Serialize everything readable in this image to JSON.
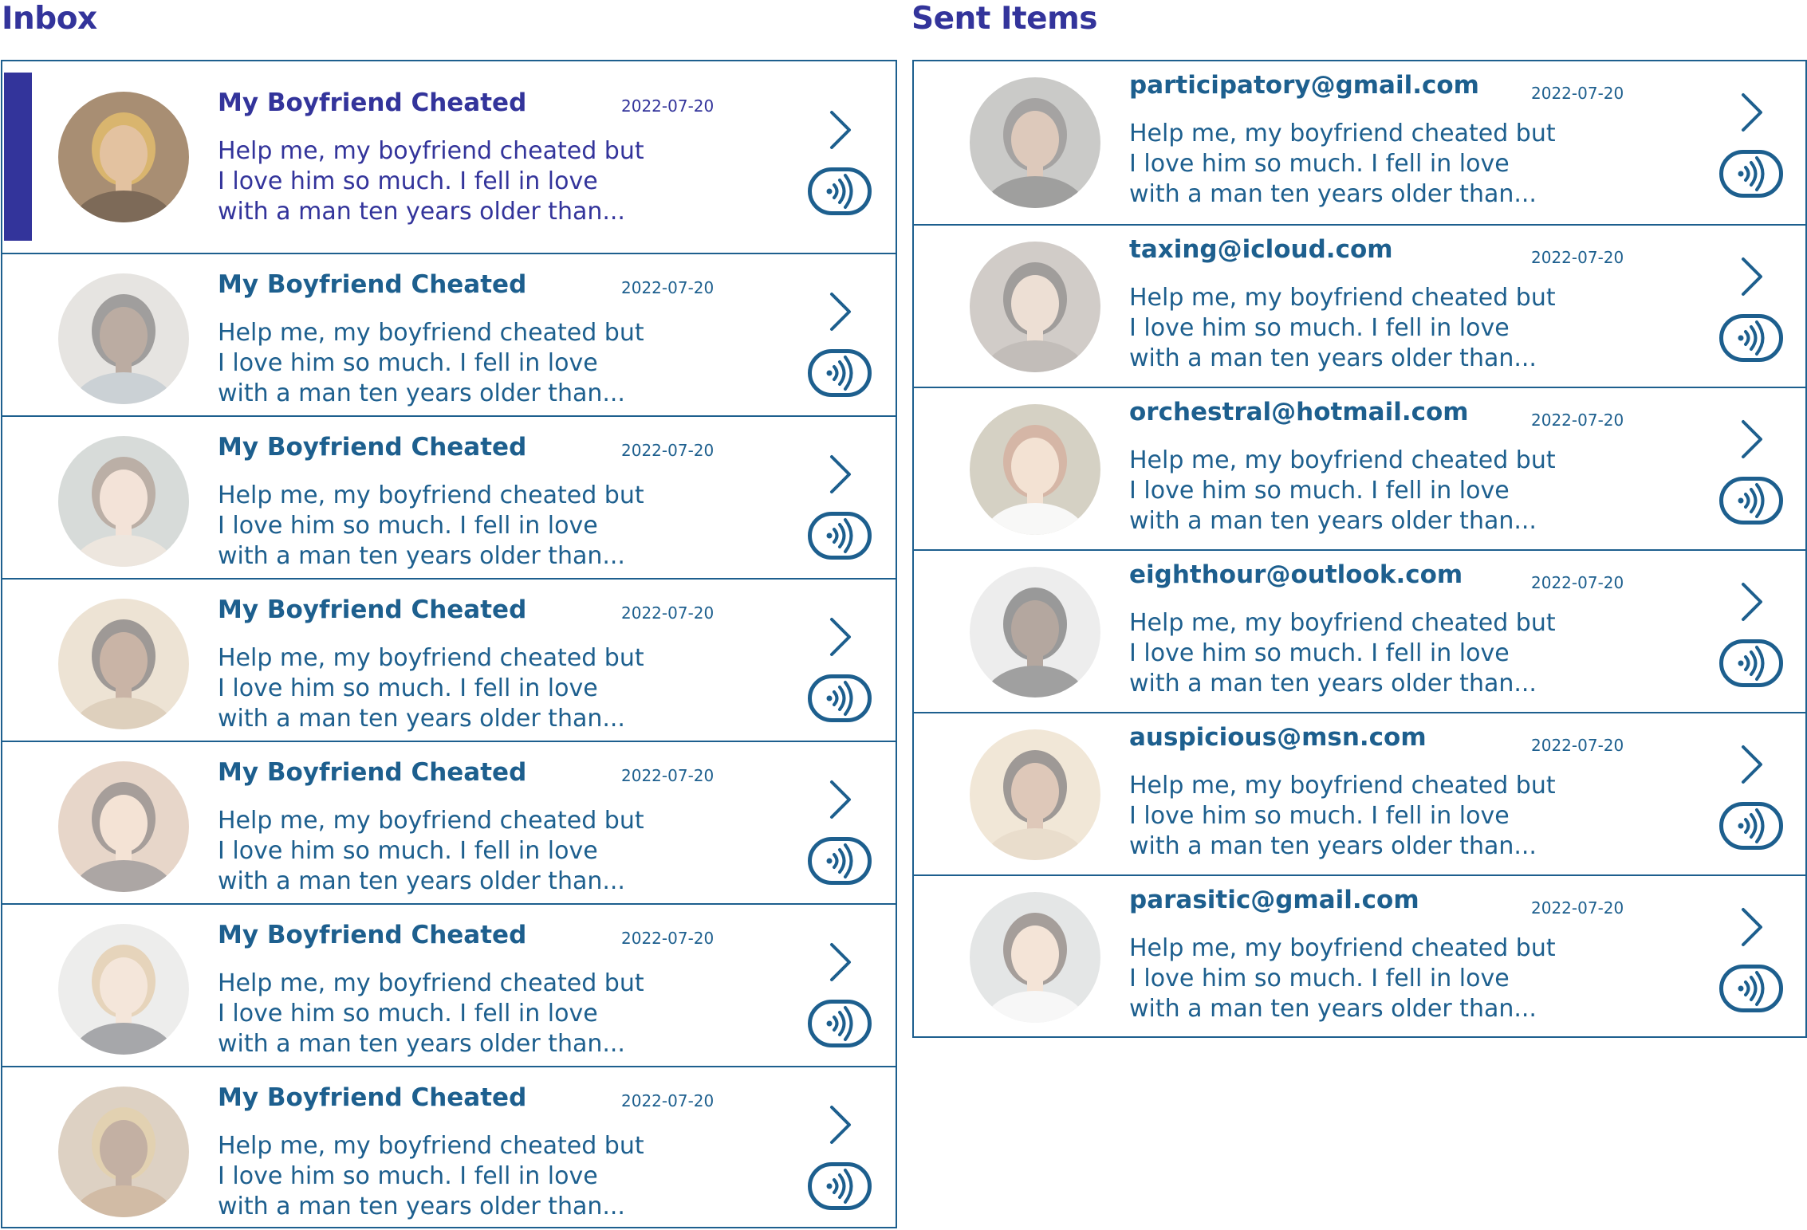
{
  "inbox": {
    "title": "Inbox",
    "items": [
      {
        "title": "My Boyfriend Cheated",
        "date": "2022-07-20",
        "preview": [
          "Help me, my boyfriend cheated but",
          "I love him so much. I fell in love",
          "with a man ten years older than..."
        ],
        "selected": true,
        "avatar_bg": "#a88e73",
        "skin": "#e3c2a0",
        "hair": "#d9b56e",
        "shirt": "#7d6a58"
      },
      {
        "title": "My Boyfriend Cheated",
        "date": "2022-07-20",
        "preview": [
          "Help me, my boyfriend cheated but",
          "I love him so much. I fell in love",
          "with a man ten years older than..."
        ],
        "selected": false,
        "avatar_bg": "#c8c4bd",
        "skin": "#6b4a33",
        "hair": "#2e2a27",
        "shirt": "#8e9aa4"
      },
      {
        "title": "My Boyfriend Cheated",
        "date": "2022-07-20",
        "preview": [
          "Help me, my boyfriend cheated but",
          "I love him so much. I fell in love",
          "with a man ten years older than..."
        ],
        "selected": false,
        "avatar_bg": "#a7b1ad",
        "skin": "#e5c3aa",
        "hair": "#6a4f3c",
        "shirt": "#d9c9b8"
      },
      {
        "title": "My Boyfriend Cheated",
        "date": "2022-07-20",
        "preview": [
          "Help me, my boyfriend cheated but",
          "I love him so much. I fell in love",
          "with a man ten years older than..."
        ],
        "selected": false,
        "avatar_bg": "#d9c2a1",
        "skin": "#8a5a3c",
        "hair": "#2a1f18",
        "shirt": "#b7986f"
      },
      {
        "title": "My Boyfriend Cheated",
        "date": "2022-07-20",
        "preview": [
          "Help me, my boyfriend cheated but",
          "I love him so much. I fell in love",
          "with a man ten years older than..."
        ],
        "selected": false,
        "avatar_bg": "#cba58a",
        "skin": "#e8c2a4",
        "hair": "#3b2a22",
        "shirt": "#4a3b38"
      },
      {
        "title": "My Boyfriend Cheated",
        "date": "2022-07-20",
        "preview": [
          "Help me, my boyfriend cheated but",
          "I love him so much. I fell in love",
          "with a man ten years older than..."
        ],
        "selected": false,
        "avatar_bg": "#d8d8d6",
        "skin": "#e8c9ae",
        "hair": "#c8a16a",
        "shirt": "#3c3d44"
      },
      {
        "title": "My Boyfriend Cheated",
        "date": "2022-07-20",
        "preview": [
          "Help me, my boyfriend cheated but",
          "I love him so much. I fell in love",
          "with a man ten years older than..."
        ],
        "selected": false,
        "avatar_bg": "#b49a7c",
        "skin": "#7b5235",
        "hair": "#c19a55",
        "shirt": "#9a6a3a"
      }
    ]
  },
  "sent": {
    "title": "Sent Items",
    "items": [
      {
        "title": "participatory@gmail.com",
        "date": "2022-07-20",
        "preview": [
          "Help me, my boyfriend cheated but",
          "I love him so much. I fell in love",
          "with a man ten years older than..."
        ],
        "selected": false,
        "avatar_bg": "#8b8b86",
        "skin": "#b58a6a",
        "hair": "#3a3633",
        "shirt": "#2d2c2b"
      },
      {
        "title": "taxing@icloud.com",
        "date": "2022-07-20",
        "preview": [
          "Help me, my boyfriend cheated but",
          "I love him so much. I fell in love",
          "with a man ten years older than..."
        ],
        "selected": false,
        "avatar_bg": "#9a8f86",
        "skin": "#d9b9a2",
        "hair": "#2f2724",
        "shirt": "#7a6e66"
      },
      {
        "title": "orchestral@hotmail.com",
        "date": "2022-07-20",
        "preview": [
          "Help me, my boyfriend cheated but",
          "I love him so much. I fell in love",
          "with a man ten years older than..."
        ],
        "selected": false,
        "avatar_bg": "#a39a7e",
        "skin": "#e6c0a0",
        "hair": "#a45f3c",
        "shirt": "#f1f0ee"
      },
      {
        "title": "eighthour@outlook.com",
        "date": "2022-07-20",
        "preview": [
          "Help me, my boyfriend cheated but",
          "I love him so much. I fell in love",
          "with a man ten years older than..."
        ],
        "selected": false,
        "avatar_bg": "#d9d9d9",
        "skin": "#5a3d2c",
        "hair": "#1f1f1f",
        "shirt": "#2f2f2f"
      },
      {
        "title": "auspicious@msn.com",
        "date": "2022-07-20",
        "preview": [
          "Help me, my boyfriend cheated but",
          "I love him so much. I fell in love",
          "with a man ten years older than..."
        ],
        "selected": false,
        "avatar_bg": "#e2cba7",
        "skin": "#b88766",
        "hair": "#2b1f18",
        "shirt": "#cfb48f"
      },
      {
        "title": "parasitic@gmail.com",
        "date": "2022-07-20",
        "preview": [
          "Help me, my boyfriend cheated but",
          "I love him so much. I fell in love",
          "with a man ten years older than..."
        ],
        "selected": false,
        "avatar_bg": "#c5c8c9",
        "skin": "#e7c4a8",
        "hair": "#3a2a22",
        "shirt": "#efefef"
      }
    ]
  },
  "colors": {
    "accent": "#33349b",
    "primary": "#1d5f8e",
    "background": "#ffffff"
  },
  "icons": {
    "open": "chevron-right-icon",
    "audio": "audio-waves-icon"
  }
}
